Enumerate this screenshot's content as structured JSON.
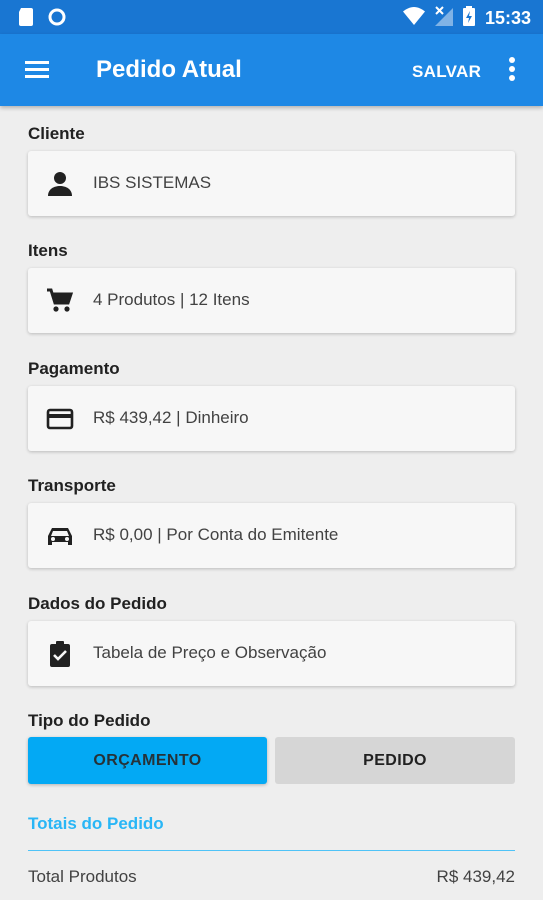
{
  "status_bar": {
    "time": "15:33",
    "left_icons": [
      "sd-card-icon",
      "circle-notification-icon"
    ],
    "right_icons": [
      "wifi-icon",
      "no-signal-icon",
      "battery-charging-icon"
    ]
  },
  "app_bar": {
    "menu_icon": "hamburger-menu-icon",
    "title": "Pedido Atual",
    "save_label": "SALVAR",
    "more_icon": "more-vert-icon"
  },
  "sections": {
    "cliente": {
      "label": "Cliente",
      "icon": "person-icon",
      "value": "IBS SISTEMAS"
    },
    "itens": {
      "label": "Itens",
      "icon": "cart-icon",
      "value": "4 Produtos | 12 Itens"
    },
    "pagamento": {
      "label": "Pagamento",
      "icon": "credit-card-icon",
      "value": "R$ 439,42 | Dinheiro"
    },
    "transporte": {
      "label": "Transporte",
      "icon": "car-icon",
      "value": "R$ 0,00 | Por Conta do Emitente"
    },
    "dados": {
      "label": "Dados do Pedido",
      "icon": "clipboard-check-icon",
      "value": "Tabela de Preço e Observação"
    }
  },
  "tipo_pedido": {
    "label": "Tipo do Pedido",
    "options": [
      "ORÇAMENTO",
      "PEDIDO"
    ],
    "selected": "ORÇAMENTO"
  },
  "totais": {
    "title": "Totais do Pedido",
    "rows": [
      {
        "label": "Total Produtos",
        "value": "R$ 439,42"
      }
    ]
  },
  "colors": {
    "status_bar": "#1976d2",
    "app_bar": "#1e88e5",
    "accent": "#03a9f4",
    "totals_title": "#29b6f6"
  }
}
